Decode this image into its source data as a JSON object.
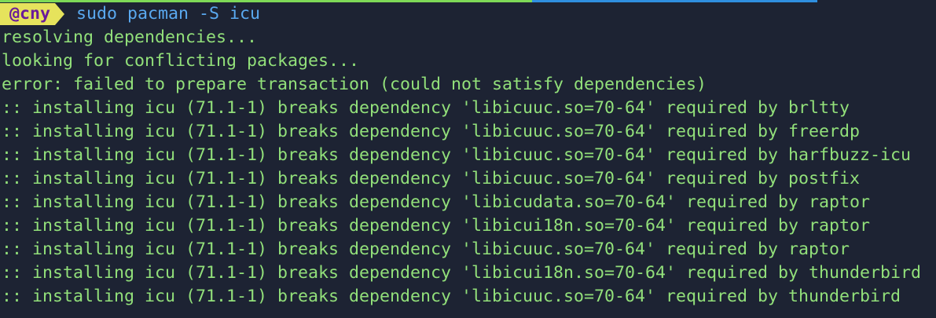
{
  "colors": {
    "background": "#1d2333",
    "output_text": "#92e07a",
    "command_text": "#5aa9f0",
    "badge_bg": "#e6e35c",
    "badge_text": "#6a1b9a",
    "topbar_left": "#7ed957",
    "topbar_right": "#2f8fe0"
  },
  "prompt": {
    "user_badge": "@cny",
    "command": "sudo pacman -S icu"
  },
  "output_lines": [
    "resolving dependencies...",
    "looking for conflicting packages...",
    "error: failed to prepare transaction (could not satisfy dependencies)",
    ":: installing icu (71.1-1) breaks dependency 'libicuuc.so=70-64' required by brltty",
    ":: installing icu (71.1-1) breaks dependency 'libicuuc.so=70-64' required by freerdp",
    ":: installing icu (71.1-1) breaks dependency 'libicuuc.so=70-64' required by harfbuzz-icu",
    ":: installing icu (71.1-1) breaks dependency 'libicuuc.so=70-64' required by postfix",
    ":: installing icu (71.1-1) breaks dependency 'libicudata.so=70-64' required by raptor",
    ":: installing icu (71.1-1) breaks dependency 'libicui18n.so=70-64' required by raptor",
    ":: installing icu (71.1-1) breaks dependency 'libicuuc.so=70-64' required by raptor",
    ":: installing icu (71.1-1) breaks dependency 'libicui18n.so=70-64' required by thunderbird",
    ":: installing icu (71.1-1) breaks dependency 'libicuuc.so=70-64' required by thunderbird"
  ]
}
